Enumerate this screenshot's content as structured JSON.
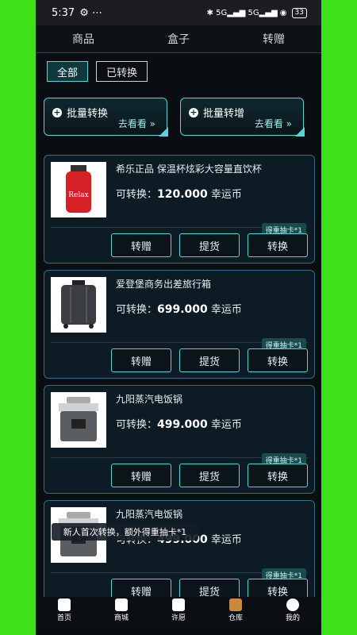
{
  "statusbar": {
    "time": "5:37",
    "battery": "33"
  },
  "nav": {
    "tabs": [
      "商品",
      "盒子",
      "转赠"
    ]
  },
  "filters": {
    "all": "全部",
    "converted": "已转换"
  },
  "bulk": [
    {
      "title": "批量转换",
      "go": "去看看 »"
    },
    {
      "title": "批量转增",
      "go": "去看看 »"
    }
  ],
  "items": [
    {
      "name": "希乐正品 保温杯炫彩大容量直饮杯",
      "price_label": "可转换：",
      "price": "120.000",
      "unit": "幸运币",
      "tag": "得重抽卡*1"
    },
    {
      "name": "爱登堡商务出差旅行箱",
      "price_label": "可转换：",
      "price": "699.000",
      "unit": "幸运币",
      "tag": "得重抽卡*1"
    },
    {
      "name": "九阳蒸汽电饭锅",
      "price_label": "可转换：",
      "price": "499.000",
      "unit": "幸运币",
      "tag": "得重抽卡*1"
    },
    {
      "name": "九阳蒸汽电饭锅",
      "price_label": "可转换：",
      "price": "499.000",
      "unit": "幸运币",
      "tag": "得重抽卡*1"
    }
  ],
  "buttons": {
    "gift": "转赠",
    "pickup": "提货",
    "convert": "转换"
  },
  "toast": "新人首次转换，额外得重抽卡*1",
  "tabbar": [
    "首页",
    "商城",
    "许愿",
    "仓库",
    "我的"
  ]
}
